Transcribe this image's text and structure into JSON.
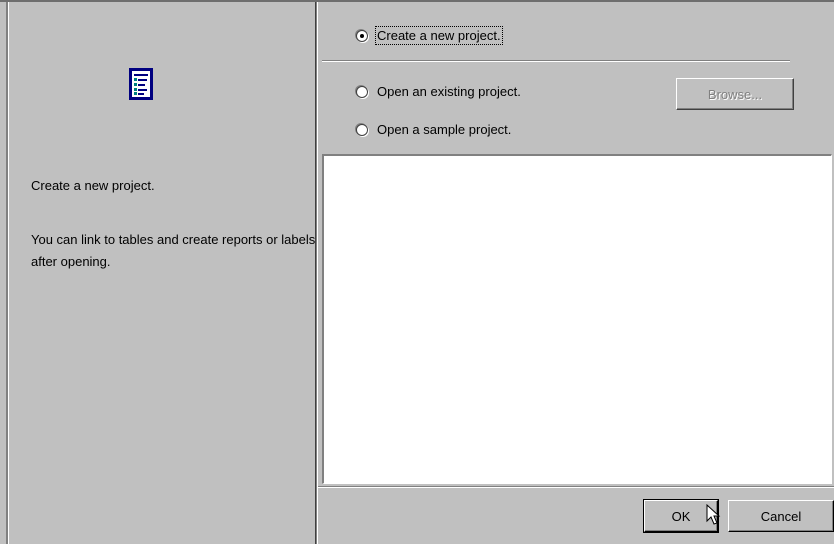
{
  "left": {
    "icon": "project-document-icon",
    "title": "Create a new project.",
    "body": "You can link to tables and create reports or labels after opening."
  },
  "options": {
    "create": {
      "label": "Create a new project.",
      "selected": true
    },
    "open": {
      "label": "Open an existing project.",
      "selected": false
    },
    "sample": {
      "label": "Open a sample project.",
      "selected": false
    }
  },
  "buttons": {
    "browse": "Browse...",
    "ok": "OK",
    "cancel": "Cancel"
  }
}
